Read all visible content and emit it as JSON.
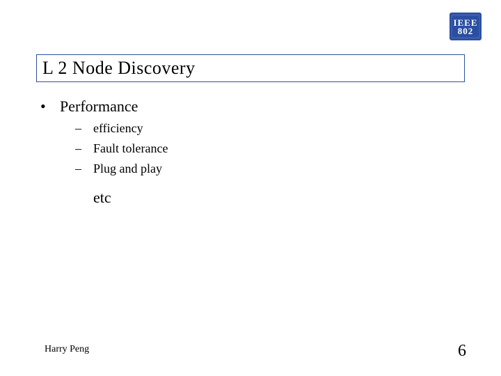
{
  "logo": {
    "line1": "IEEE",
    "line2": "802"
  },
  "title": "L 2 Node Discovery",
  "bullets": {
    "lvl1": "Performance",
    "lvl2": [
      "efficiency",
      "Fault tolerance",
      "Plug and play"
    ],
    "extra": "etc"
  },
  "footer": {
    "author": "Harry Peng",
    "page": "6"
  }
}
